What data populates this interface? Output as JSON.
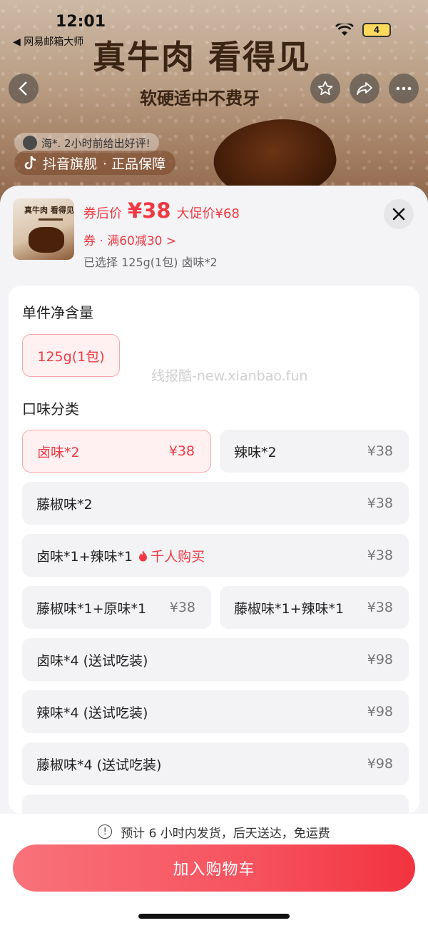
{
  "status_bar": {
    "time": "12:01",
    "back_app": "◀ 网易邮箱大师",
    "battery": "4"
  },
  "hero": {
    "headline": "真牛肉 看得见",
    "subline": "软硬适中不费牙",
    "review_text": "海*. 2小时前给出好评!",
    "store_label": "抖音旗舰",
    "store_suffix": "· 正品保障"
  },
  "product": {
    "thumb_title": "真牛肉 看得见",
    "price_label": "券后价",
    "price_value": "¥38",
    "promo_price": "大促价¥68",
    "coupon": "券 · 满60减30 >",
    "selected": "已选择 125g(1包) 卤味*2"
  },
  "options": {
    "size_title": "单件净含量",
    "size_option": "125g(1包)",
    "watermark": "线报酷-new.xianbao.fun",
    "flavor_title": "口味分类",
    "flavors": [
      {
        "label": "卤味*2",
        "price": "¥38"
      },
      {
        "label": "辣味*2",
        "price": "¥38"
      },
      {
        "label": "藤椒味*2",
        "price": "¥38"
      },
      {
        "label": "卤味*1+辣味*1",
        "price": "¥38",
        "hot": "千人购买"
      },
      {
        "label": "藤椒味*1+原味*1",
        "price": "¥38"
      },
      {
        "label": "藤椒味*1+辣味*1",
        "price": "¥38"
      },
      {
        "label": "卤味*4 (送试吃装)",
        "price": "¥98"
      },
      {
        "label": "辣味*4 (送试吃装)",
        "price": "¥98"
      },
      {
        "label": "藤椒味*4 (送试吃装)",
        "price": "¥98"
      }
    ]
  },
  "shipping_note": "预计 6 小时内发货，后天送达，免运费",
  "cart_button": "加入购物车"
}
